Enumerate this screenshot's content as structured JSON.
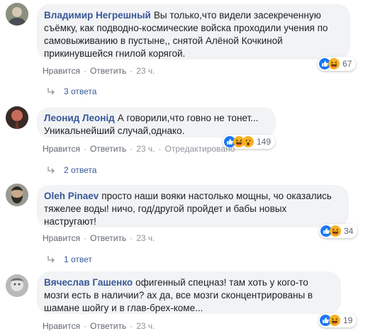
{
  "colors": {
    "link": "#385898",
    "meta": "#606770",
    "bubble": "#f2f3f5",
    "like": "#1877f2",
    "haha": "#f7b125"
  },
  "comments": [
    {
      "author": "Владимир Негрешный",
      "text": "Вы только,что видели засекреченную съёмку, как подводно-космические войска проходили учения по самовыживанию в пустыне,, снятой Алёной Кочкиной прикинувшейся гнилой корягой.",
      "reactions": [
        "like-icon",
        "haha-icon"
      ],
      "reaction_count": "67",
      "like_label": "Нравится",
      "reply_label": "Ответить",
      "time": "23 ч.",
      "edited": "",
      "replies_label": "3 ответа"
    },
    {
      "author": "Леонид Леонід",
      "text": "А говорили,что говно не тонет... Уникальнейший случай,однако.",
      "reactions": [
        "like-icon",
        "haha-icon",
        "wow-icon"
      ],
      "reaction_count": "149",
      "like_label": "Нравится",
      "reply_label": "Ответить",
      "time": "23 ч.",
      "edited": "Отредактировано",
      "replies_label": "2 ответа"
    },
    {
      "author": "Oleh Pinaev",
      "text": "просто наши вояки настолько мощны, чо оказались тяжелее воды! ничо, год/другой пройдет и бабы новых настругают!",
      "reactions": [
        "like-icon",
        "haha-icon"
      ],
      "reaction_count": "34",
      "like_label": "Нравится",
      "reply_label": "Ответить",
      "time": "23 ч.",
      "edited": "",
      "replies_label": "1 ответ"
    },
    {
      "author": "Вячеслав Гашенко",
      "text": "офигенный спецназ! там хоть у кого-то мозги есть в наличии? ах да, все мозги сконцентрированы в шамане шойгу и в глав-брех-коме...",
      "reactions": [
        "like-icon",
        "haha-icon"
      ],
      "reaction_count": "19",
      "like_label": "Нравится",
      "reply_label": "Ответить",
      "time": "23 ч.",
      "edited": "",
      "replies_label": ""
    }
  ]
}
